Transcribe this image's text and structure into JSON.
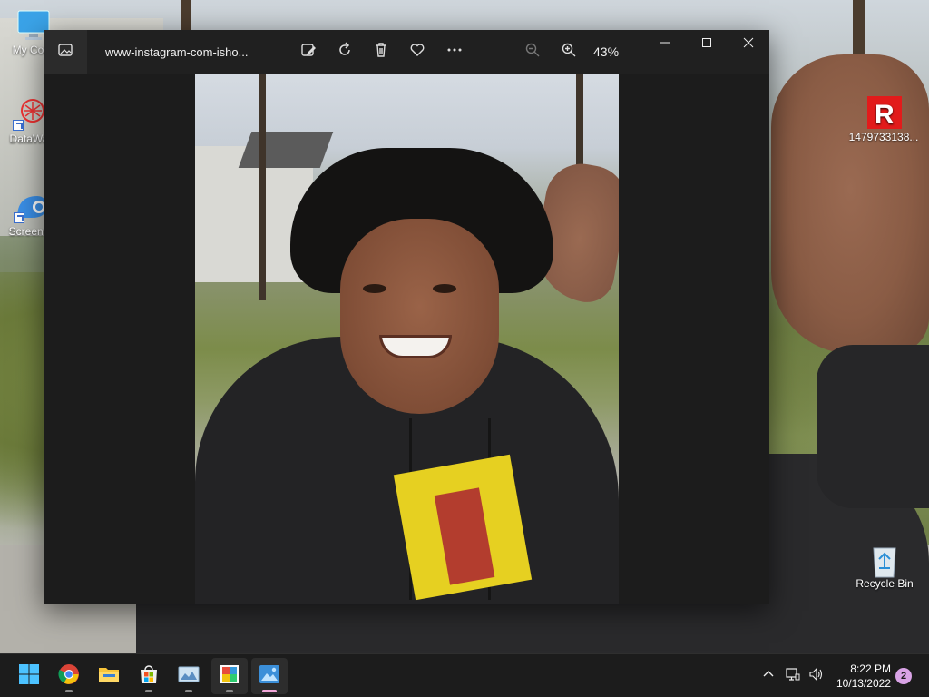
{
  "desktop": {
    "icons": [
      {
        "label": "My Com",
        "icon": "monitor-icon"
      },
      {
        "label": "DataWa",
        "icon": "datawave-icon"
      },
      {
        "label": "ScreenC",
        "icon": "screen-capture-icon"
      },
      {
        "label": "1479733138...",
        "icon": "roblox-icon"
      },
      {
        "label": "Recycle Bin",
        "icon": "recycle-bin-icon"
      }
    ]
  },
  "photos_window": {
    "title": "www-instagram-com-isho...",
    "zoom_label": "43%",
    "toolbar": [
      {
        "name": "edit-image-button",
        "icon": "edit-image-icon"
      },
      {
        "name": "rotate-button",
        "icon": "rotate-icon"
      },
      {
        "name": "delete-button",
        "icon": "trash-icon"
      },
      {
        "name": "favorite-button",
        "icon": "heart-icon"
      },
      {
        "name": "more-options-button",
        "icon": "ellipsis-icon"
      },
      {
        "name": "zoom-out-button",
        "icon": "zoom-out-icon"
      },
      {
        "name": "zoom-in-button",
        "icon": "zoom-in-icon"
      }
    ],
    "window_controls": [
      "minimize",
      "maximize",
      "close"
    ]
  },
  "taskbar": {
    "apps": [
      {
        "name": "start-button",
        "icon": "windows-logo-icon",
        "active": false,
        "running": false
      },
      {
        "name": "chrome-button",
        "icon": "chrome-icon",
        "active": false,
        "running": true
      },
      {
        "name": "file-explorer-button",
        "icon": "folder-icon",
        "active": false,
        "running": false
      },
      {
        "name": "microsoft-store-button",
        "icon": "store-icon",
        "active": false,
        "running": true
      },
      {
        "name": "image-viewer-button",
        "icon": "image-app-icon",
        "active": false,
        "running": true
      },
      {
        "name": "paint-app-button",
        "icon": "paint-icon",
        "active": true,
        "running": true
      },
      {
        "name": "photos-app-button",
        "icon": "photos-icon",
        "active": true,
        "running": true
      }
    ],
    "tray": {
      "time": "8:22 PM",
      "date": "10/13/2022",
      "notification_count": "2"
    }
  },
  "colors": {
    "window_bg": "#1f1f1f",
    "titlebar_bg": "#202020",
    "taskbar_bg": "#1c1c1c",
    "accent": "#8ab4f8",
    "notification_badge": "#d9a3e6"
  }
}
